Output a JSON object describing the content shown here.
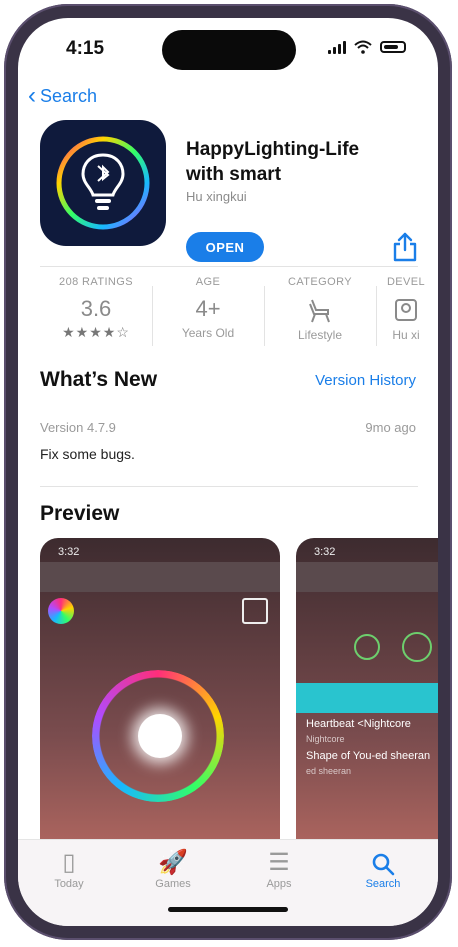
{
  "status": {
    "time": "4:15"
  },
  "nav": {
    "back_label": "Search"
  },
  "app": {
    "title_line1": "HappyLighting-Life",
    "title_line2": "with smart",
    "developer": "Hu xingkui",
    "open_label": "OPEN"
  },
  "info": {
    "ratings_label": "208 RATINGS",
    "ratings_value": "3.6",
    "stars": "★★★★☆",
    "age_label": "AGE",
    "age_value": "4+",
    "age_sub": "Years Old",
    "category_label": "CATEGORY",
    "category_sub": "Lifestyle",
    "developer_label": "DEVEL",
    "developer_sub": "Hu xi"
  },
  "whats_new": {
    "title": "What’s New",
    "history_link": "Version History",
    "version": "Version 4.7.9",
    "ago": "9mo ago",
    "notes": "Fix some bugs."
  },
  "preview": {
    "title": "Preview",
    "shot_time": "3:32",
    "shot2_rows": [
      {
        "title": "Heartbeat <Nightcore",
        "sub": "Nightcore"
      },
      {
        "title": "Shape of You-ed sheeran",
        "sub": "ed sheeran"
      }
    ]
  },
  "tabs": [
    {
      "label": "Today",
      "icon": "today-icon"
    },
    {
      "label": "Games",
      "icon": "rocket-icon"
    },
    {
      "label": "Apps",
      "icon": "stack-icon"
    },
    {
      "label": "Search",
      "icon": "search-icon"
    }
  ]
}
